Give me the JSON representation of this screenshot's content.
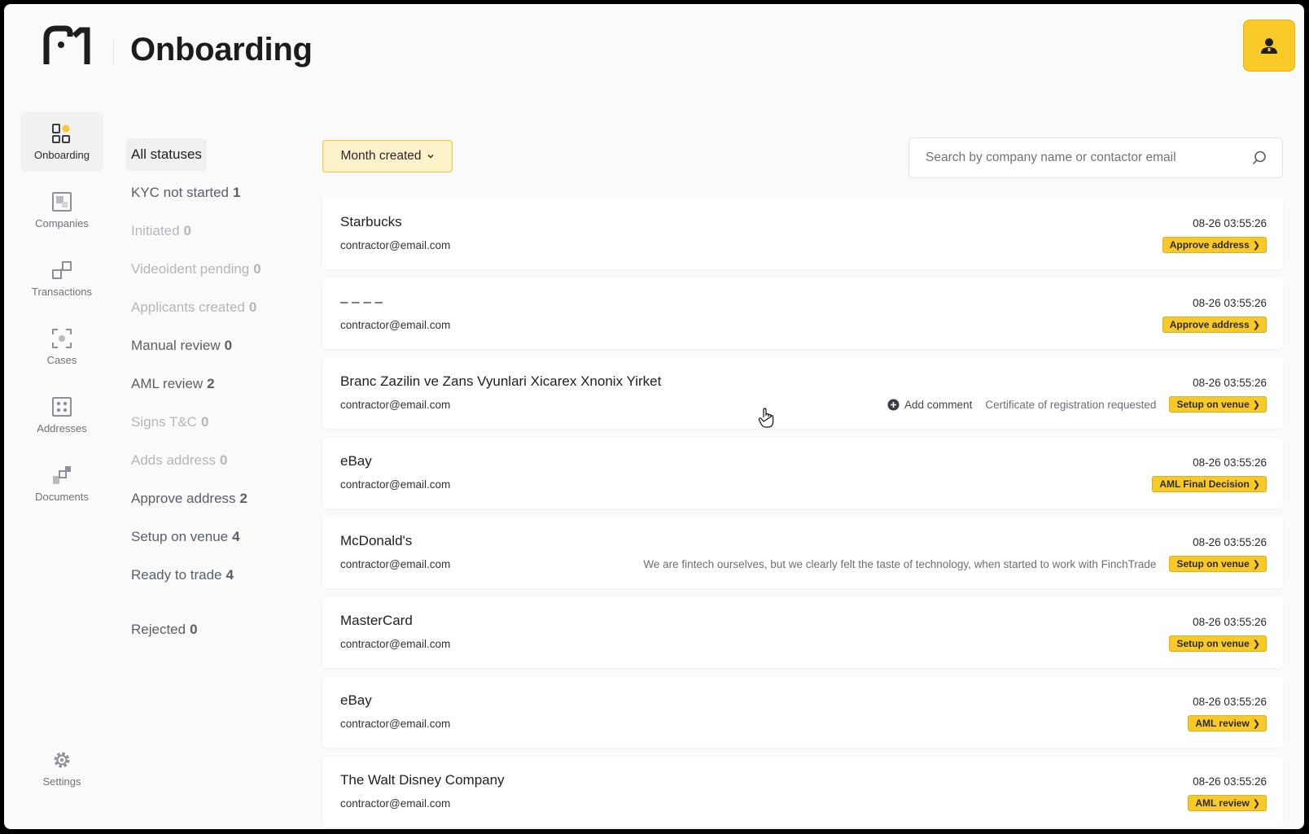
{
  "header": {
    "title": "Onboarding"
  },
  "nav": {
    "items": [
      {
        "label": "Onboarding",
        "icon": "onboarding-icon",
        "active": true
      },
      {
        "label": "Companies",
        "icon": "companies-icon"
      },
      {
        "label": "Transactions",
        "icon": "transactions-icon"
      },
      {
        "label": "Cases",
        "icon": "cases-icon"
      },
      {
        "label": "Addresses",
        "icon": "addresses-icon"
      },
      {
        "label": "Documents",
        "icon": "documents-icon"
      }
    ],
    "settings": {
      "label": "Settings",
      "icon": "gear-icon"
    }
  },
  "statuses": [
    {
      "label": "All statuses",
      "count": ""
    },
    {
      "label": "KYC not started",
      "count": "1"
    },
    {
      "label": "Initiated",
      "count": "0"
    },
    {
      "label": "Videoident pending",
      "count": "0"
    },
    {
      "label": "Applicants created",
      "count": "0"
    },
    {
      "label": "Manual review",
      "count": "0"
    },
    {
      "label": "AML review",
      "count": "2"
    },
    {
      "label": "Signs T&C",
      "count": "0"
    },
    {
      "label": "Adds address",
      "count": "0"
    },
    {
      "label": "Approve address",
      "count": "2"
    },
    {
      "label": "Setup on venue",
      "count": "4"
    },
    {
      "label": "Ready to trade",
      "count": "4"
    },
    {
      "label": "Rejected",
      "count": "0"
    }
  ],
  "filters": {
    "month_label": "Month created"
  },
  "search": {
    "placeholder": "Search by company name or contactor email"
  },
  "rows": [
    {
      "name": "Starbucks",
      "email": "contractor@email.com",
      "time": "08-26 03:55:26",
      "badge": "Approve address",
      "note": "",
      "comment": ""
    },
    {
      "name": "– – – –",
      "email": "contractor@email.com",
      "time": "08-26 03:55:26",
      "badge": "Approve address",
      "note": "",
      "comment": ""
    },
    {
      "name": "Branc Zazilin ve Zans Vyunlari Xicarex Xnonix Yirket",
      "email": "contractor@email.com",
      "time": "08-26 03:55:26",
      "badge": "Setup on venue",
      "note": "Certificate of registration requested",
      "comment": "Add comment"
    },
    {
      "name": "eBay",
      "email": "contractor@email.com",
      "time": "08-26 03:55:26",
      "badge": "AML Final Decision",
      "note": "",
      "comment": ""
    },
    {
      "name": "McDonald's",
      "email": "contractor@email.com",
      "time": "08-26 03:55:26",
      "badge": "Setup on venue",
      "note": "We are fintech ourselves, but we clearly felt the taste of technology, when started to work with FinchTrade",
      "comment": ""
    },
    {
      "name": "MasterCard",
      "email": "contractor@email.com",
      "time": "08-26 03:55:26",
      "badge": "Setup on venue",
      "note": "",
      "comment": ""
    },
    {
      "name": "eBay",
      "email": "contractor@email.com",
      "time": "08-26 03:55:26",
      "badge": "AML review",
      "note": "",
      "comment": ""
    },
    {
      "name": "The Walt Disney Company",
      "email": "contractor@email.com",
      "time": "08-26 03:55:26",
      "badge": "AML review",
      "note": "",
      "comment": ""
    }
  ],
  "colors": {
    "accent": "#f9c927",
    "accent_soft": "#fdf2c9",
    "background": "#fafafa"
  }
}
